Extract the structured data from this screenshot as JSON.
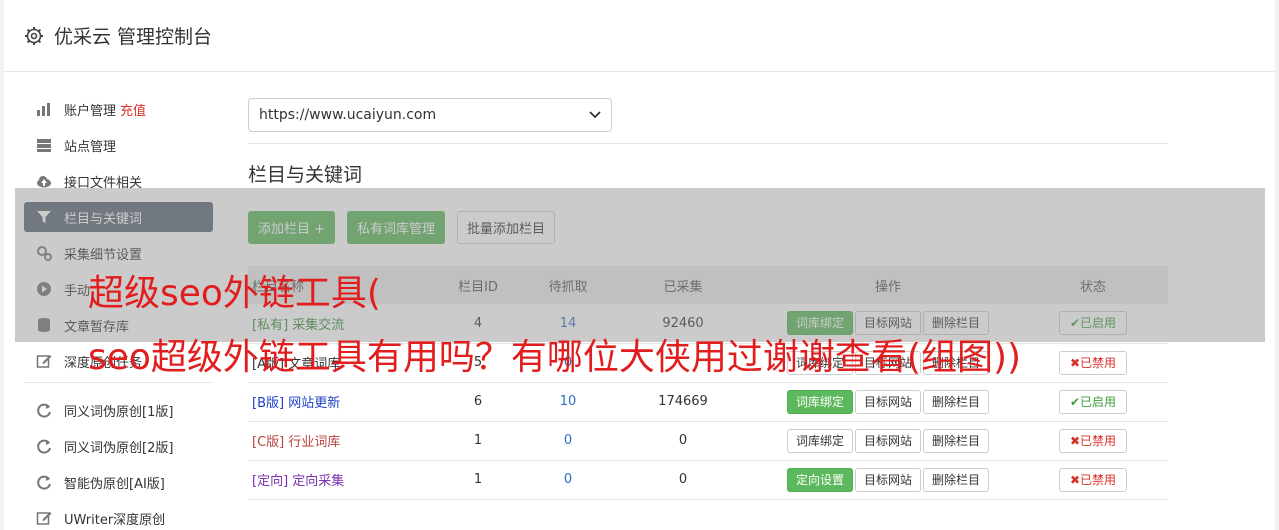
{
  "app": {
    "title": "优采云 管理控制台"
  },
  "sidebar": {
    "items": [
      {
        "label": "账户管理",
        "extra": "充值",
        "icon": "bar-chart-icon"
      },
      {
        "label": "站点管理",
        "icon": "server-icon"
      },
      {
        "label": "接口文件相关",
        "icon": "cloud-upload-icon"
      },
      {
        "label": "栏目与关键词",
        "icon": "filter-icon",
        "active": true
      },
      {
        "label": "采集细节设置",
        "icon": "gears-icon"
      },
      {
        "label": "手动",
        "icon": "play-icon"
      },
      {
        "label": "文章暂存库",
        "icon": "database-icon"
      },
      {
        "label": "深度原创任务",
        "icon": "edit-icon"
      },
      {
        "label": "同义词伪原创[1版]",
        "icon": "refresh-icon"
      },
      {
        "label": "同义词伪原创[2版]",
        "icon": "refresh-icon"
      },
      {
        "label": "智能伪原创[AI版]",
        "icon": "refresh-icon"
      },
      {
        "label": "UWriter深度原创",
        "icon": "edit-icon"
      }
    ]
  },
  "main": {
    "site_select": "https://www.ucaiyun.com",
    "section_title": "栏目与关键词",
    "buttons": {
      "add": "添加栏目 +",
      "private": "私有词库管理",
      "batch": "批量添加栏目"
    },
    "table": {
      "headers": {
        "name": "栏目名称",
        "id": "栏目ID",
        "pending": "待抓取",
        "collected": "已采集",
        "ops": "操作",
        "status": "状态"
      },
      "rows": [
        {
          "tag": "[私有]",
          "name": "采集交流",
          "id": "4",
          "pending": "14",
          "collected": "92460",
          "op1": "词库绑定",
          "op1_green": true,
          "op2": "目标网站",
          "op3": "删除栏目",
          "status": "✔已启用",
          "on": true,
          "color": "#3c8a3c"
        },
        {
          "tag": "[A版]",
          "name": "文章词库",
          "id": "5",
          "pending": "0",
          "collected": "",
          "op1": "词库绑定",
          "op1_green": false,
          "op2": "目标网站",
          "op3": "删除栏目",
          "status": "✖已禁用",
          "on": false,
          "color": "#333333"
        },
        {
          "tag": "[B版]",
          "name": "网站更新",
          "id": "6",
          "pending": "10",
          "collected": "174669",
          "op1": "词库绑定",
          "op1_green": true,
          "op2": "目标网站",
          "op3": "删除栏目",
          "status": "✔已启用",
          "on": true,
          "color": "#1a3fc8"
        },
        {
          "tag": "[C版]",
          "name": "行业词库",
          "id": "1",
          "pending": "0",
          "collected": "0",
          "op1": "词库绑定",
          "op1_green": false,
          "op2": "目标网站",
          "op3": "删除栏目",
          "status": "✖已禁用",
          "on": false,
          "color": "#b8433a"
        },
        {
          "tag": "[定向]",
          "name": "定向采集",
          "id": "1",
          "pending": "0",
          "collected": "0",
          "op1": "定向设置",
          "op1_green": true,
          "op2": "目标网站",
          "op3": "删除栏目",
          "status": "✖已禁用",
          "on": false,
          "color": "#7a2fb0"
        }
      ]
    }
  },
  "overlay": {
    "line1": "超级seo外链工具(",
    "line2": "seo超级外链工具有用吗？有哪位大侠用过谢谢查看(组图))"
  }
}
